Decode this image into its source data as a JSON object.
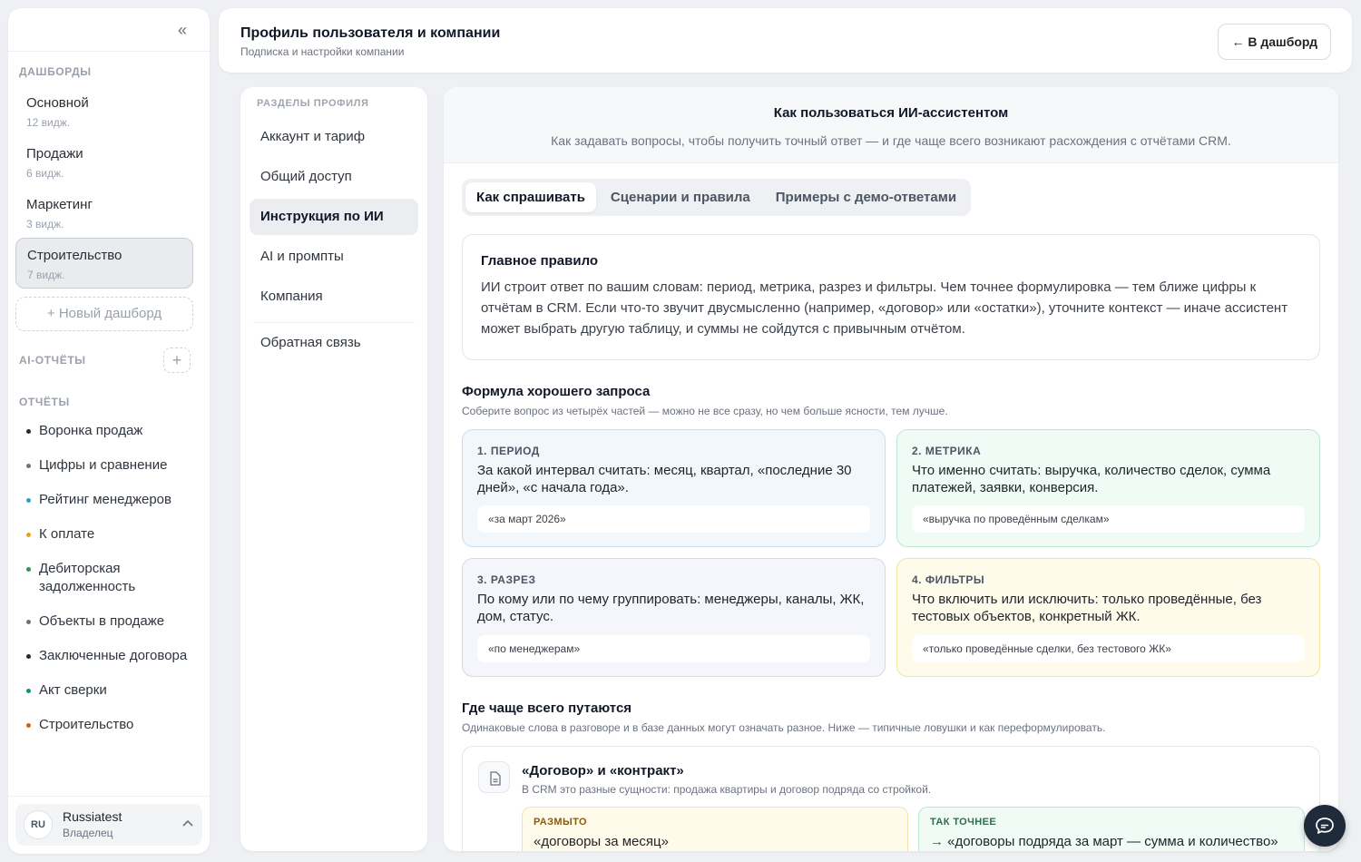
{
  "sidebar": {
    "dashboards_label": "ДАШБОРДЫ",
    "dashboards": [
      {
        "name": "Основной",
        "widgets": "12 видж."
      },
      {
        "name": "Продажи",
        "widgets": "6 видж."
      },
      {
        "name": "Маркетинг",
        "widgets": "3 видж."
      },
      {
        "name": "Строительство",
        "widgets": "7 видж."
      }
    ],
    "new_dashboard": "+ Новый дашборд",
    "ai_reports_label": "AI-ОТЧЁТЫ",
    "reports_label": "ОТЧЁТЫ",
    "reports": [
      {
        "name": "Воронка продаж",
        "color": "#1f2937"
      },
      {
        "name": "Цифры и сравнение",
        "color": "#6b7280"
      },
      {
        "name": "Рейтинг менеджеров",
        "color": "#22a3d6"
      },
      {
        "name": "К оплате",
        "color": "#f59e0b"
      },
      {
        "name": "Дебиторская задолженность",
        "color": "#16a34a"
      },
      {
        "name": "Объекты в продаже",
        "color": "#64748b"
      },
      {
        "name": "Заключенные договора",
        "color": "#1f2937"
      },
      {
        "name": "Акт сверки",
        "color": "#0d9488"
      },
      {
        "name": "Строительство",
        "color": "#ea580c"
      }
    ],
    "user": {
      "initials": "RU",
      "name": "Russiatest",
      "role": "Владелец"
    }
  },
  "header": {
    "title": "Профиль пользователя и компании",
    "subtitle": "Подписка и настройки компании",
    "back_label": "В дашборд"
  },
  "profile_nav": {
    "label": "РАЗДЕЛЫ ПРОФИЛЯ",
    "items": [
      "Аккаунт и тариф",
      "Общий доступ",
      "Инструкция по ИИ",
      "AI и промпты",
      "Компания"
    ],
    "feedback": "Обратная связь"
  },
  "main": {
    "title": "Как пользоваться ИИ-ассистентом",
    "subtitle": "Как задавать вопросы, чтобы получить точный ответ — и где чаще всего возникают расхождения с отчётами CRM.",
    "tabs": [
      "Как спрашивать",
      "Сценарии и правила",
      "Примеры с демо-ответами"
    ],
    "rule": {
      "title": "Главное правило",
      "text": "ИИ строит ответ по вашим словам: период, метрика, разрез и фильтры. Чем точнее формулировка — тем ближе цифры к отчётам в CRM. Если что-то звучит двусмысленно (например, «договор» или «остатки»), уточните контекст — иначе ассистент может выбрать другую таблицу, и суммы не сойдутся с привычным отчётом."
    },
    "formula": {
      "title": "Формула хорошего запроса",
      "subtitle": "Соберите вопрос из четырёх частей — можно не все сразу, но чем больше ясности, тем лучше.",
      "cards": [
        {
          "head": "1. ПЕРИОД",
          "text": "За какой интервал считать: месяц, квартал, «последние 30 дней», «с начала года».",
          "example": "«за март 2026»"
        },
        {
          "head": "2. МЕТРИКА",
          "text": "Что именно считать: выручка, количество сделок, сумма платежей, заявки, конверсия.",
          "example": "«выручка по проведённым сделкам»"
        },
        {
          "head": "3. РАЗРЕЗ",
          "text": "По кому или по чему группировать: менеджеры, каналы, ЖК, дом, статус.",
          "example": "«по менеджерам»"
        },
        {
          "head": "4. ФИЛЬТРЫ",
          "text": "Что включить или исключить: только проведённые, без тестовых объектов, конкретный ЖК.",
          "example": "«только проведённые сделки, без тестового ЖК»"
        }
      ]
    },
    "confusion": {
      "title": "Где чаще всего путаются",
      "subtitle": "Одинаковые слова в разговоре и в базе данных могут означать разное. Ниже — типичные ловушки и как переформулировать.",
      "item": {
        "title": "«Договор» и «контракт»",
        "subtitle": "В CRM это разные сущности: продажа квартиры и договор подряда со стройкой.",
        "vague_label": "РАЗМЫТО",
        "vague_text": "«договоры за месяц»",
        "precise_label": "ТАК ТОЧНЕЕ",
        "precise_text": "«договоры подряда за март — сумма и количество»"
      }
    }
  }
}
